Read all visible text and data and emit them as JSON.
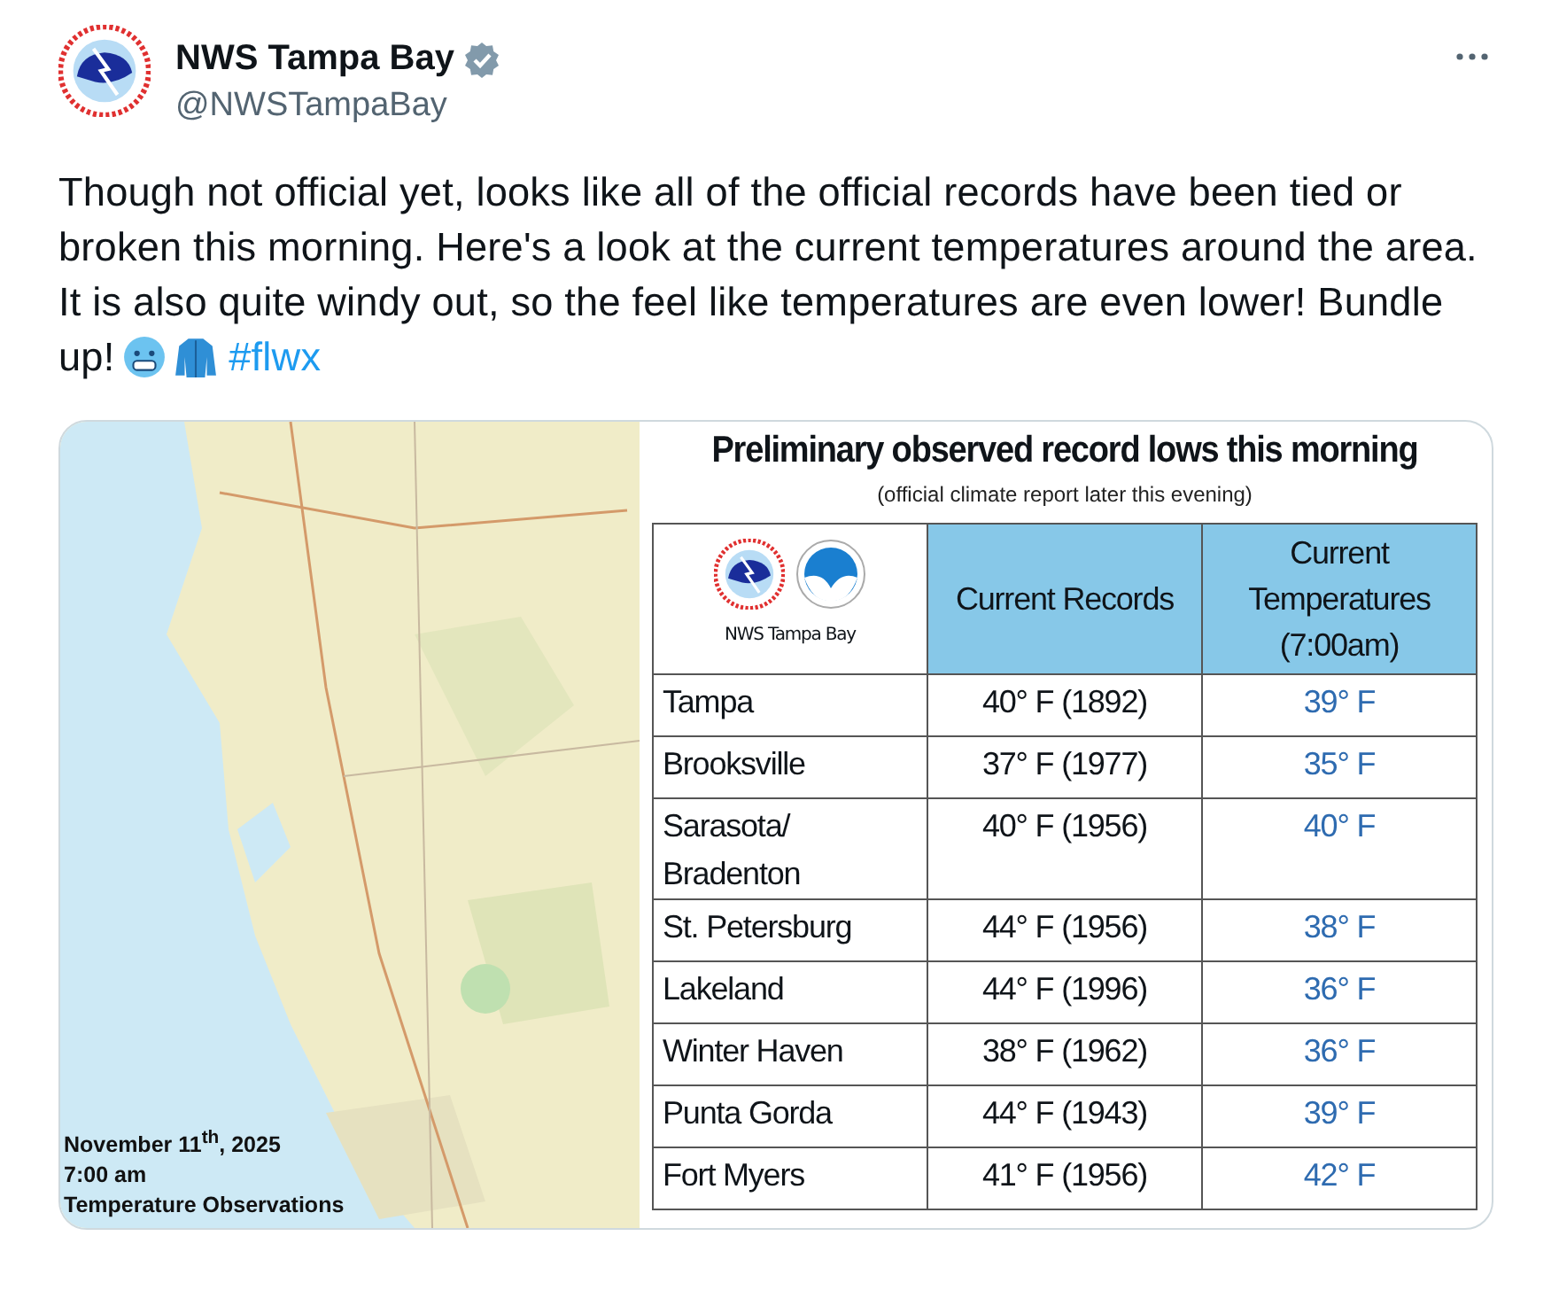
{
  "author": {
    "name": "NWS Tampa Bay",
    "verified": true,
    "handle": "@NWSTampaBay"
  },
  "post": {
    "text": "Though not official yet, looks like all of the official records have been tied or broken this morning. Here's a look at the current temperatures around the area. It is also quite windy out, so the feel like temperatures are even lower! Bundle up!",
    "hashtag": "#flwx"
  },
  "media": {
    "map": {
      "kind": "picture",
      "caption": [
        "November 11$^{th}$, 2025",
        "7:00 am",
        "Temperature Observations"
      ]
    },
    "title": "Preliminary observed record lows this morning",
    "subtitle": "(official climate report later this evening)",
    "logo_caption": "NWS Tampa Bay",
    "columns": [
      "Current Records",
      "Current Temperatures (7:00am)"
    ],
    "rows": [
      {
        "city": "Tampa",
        "record": "40° F (1892)",
        "current": "39° F"
      },
      {
        "city": "Brooksville",
        "record": "37° F (1977)",
        "current": "35° F"
      },
      {
        "city": "Sarasota/ Bradenton",
        "record": "40° F (1956)",
        "current": "40° F"
      },
      {
        "city": "St. Petersburg",
        "record": "44° F (1956)",
        "current": "38° F"
      },
      {
        "city": "Lakeland",
        "record": "44° F (1996)",
        "current": "36° F"
      },
      {
        "city": "Winter Haven",
        "record": "38° F (1962)",
        "current": "36° F"
      },
      {
        "city": "Punta Gorda",
        "record": "44° F (1943)",
        "current": "39° F"
      },
      {
        "city": "Fort Myers",
        "record": "41° F (1956)",
        "current": "42° F"
      }
    ]
  }
}
